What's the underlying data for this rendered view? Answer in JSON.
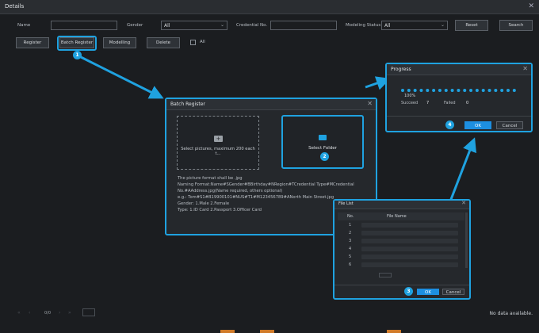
{
  "window": {
    "title": "Details"
  },
  "filters": {
    "name_label": "Name",
    "gender_label": "Gender",
    "gender_value": "All",
    "credential_label": "Credential No.",
    "modeling_label": "Modeling Status",
    "modeling_value": "All",
    "reset_label": "Reset",
    "search_label": "Search"
  },
  "toolbar": {
    "register_label": "Register",
    "batch_register_label": "Batch Register",
    "modelling_label": "Modelling",
    "delete_label": "Delete",
    "all_label": "All"
  },
  "batch_dialog": {
    "title": "Batch Register",
    "select_pictures_text": "Select pictures, maximum 200 each t...",
    "select_folder_text": "Select Folder",
    "info_lines": [
      "The picture format shall be .jpg",
      "Naming Format:Name#SGender#BBirthday#NRegion#TCredential Type#MCredential",
      "No.#AAddress.jpg(Name required, others optional)",
      "e.g.: Tom#S1#B19900101#NUS#T1#M123456789#ANorth Main Street.jpg",
      "Gender: 1.Male 2.Female",
      "Type: 1.ID Card 2.Passport 3.Officer Card"
    ]
  },
  "progress_dialog": {
    "title": "Progress",
    "percent": "100%",
    "percent_value": 100,
    "succeed_label": "Succeed",
    "succeed_value": "7",
    "failed_label": "Failed",
    "failed_value": "0",
    "ok_label": "OK",
    "cancel_label": "Cancel"
  },
  "file_list_dialog": {
    "title": "File List",
    "col_no": "No.",
    "col_name": "File Name",
    "rows": [
      "1",
      "2",
      "3",
      "4",
      "5",
      "6"
    ],
    "ok_label": "OK",
    "cancel_label": "Cancel"
  },
  "pagination": {
    "page_info": "0/0"
  },
  "status": {
    "no_data": "No data available."
  },
  "badges": {
    "b1": "1",
    "b2": "2",
    "b3": "3",
    "b4": "4"
  },
  "colors": {
    "accent": "#1fa2e0",
    "ok": "#1d8fe1",
    "background": "#1b1d20"
  }
}
